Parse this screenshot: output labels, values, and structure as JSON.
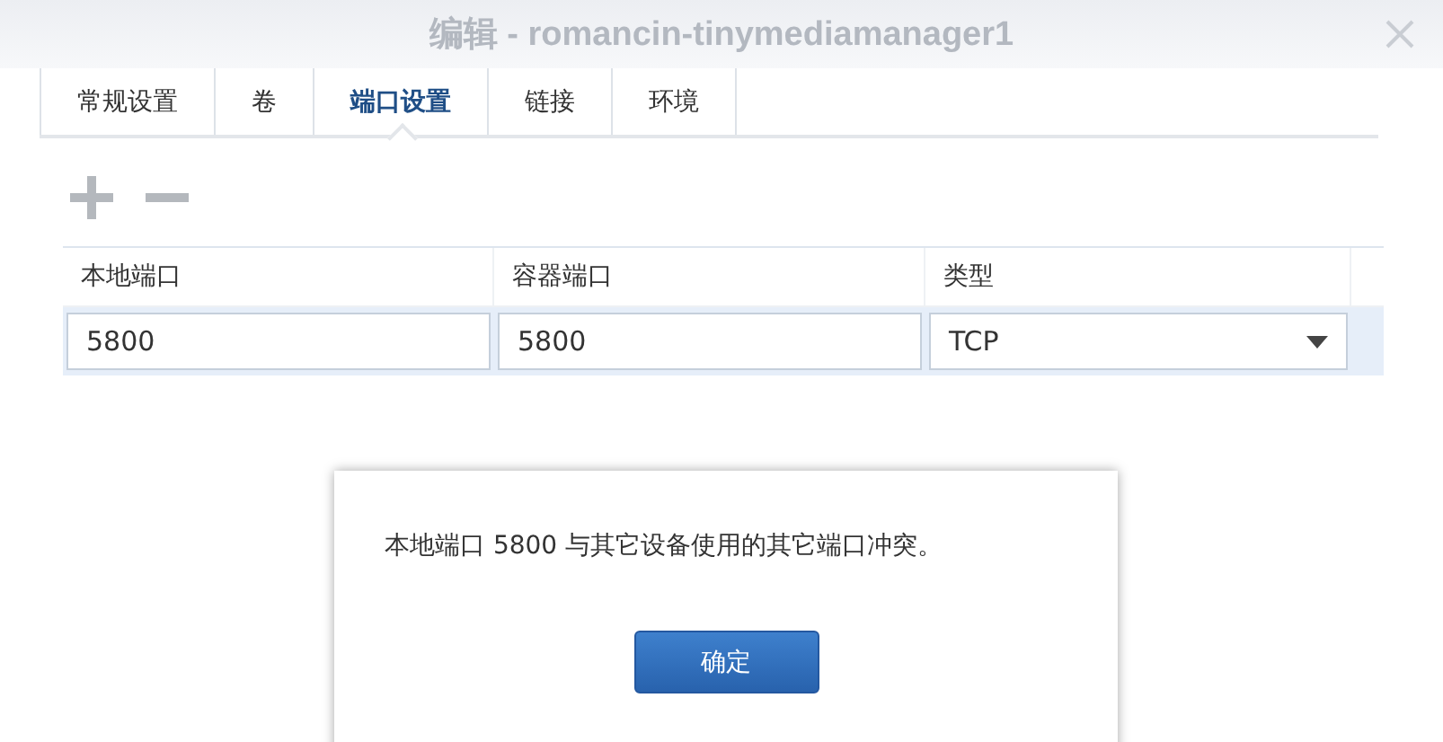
{
  "window": {
    "title": "编辑 - romancin-tinymediamanager1"
  },
  "tabs": [
    {
      "label": "常规设置",
      "selected": false
    },
    {
      "label": "卷",
      "selected": false
    },
    {
      "label": "端口设置",
      "selected": true
    },
    {
      "label": "链接",
      "selected": false
    },
    {
      "label": "环境",
      "selected": false
    }
  ],
  "table": {
    "columns": [
      "本地端口",
      "容器端口",
      "类型"
    ],
    "rows": [
      {
        "cells": [
          {
            "kind": "input",
            "value": "5800"
          },
          {
            "kind": "input",
            "value": "5800"
          },
          {
            "kind": "select",
            "value": "TCP"
          }
        ]
      }
    ]
  },
  "dialog": {
    "message": "本地端口 5800 与其它设备使用的其它端口冲突。",
    "button": "确定"
  }
}
